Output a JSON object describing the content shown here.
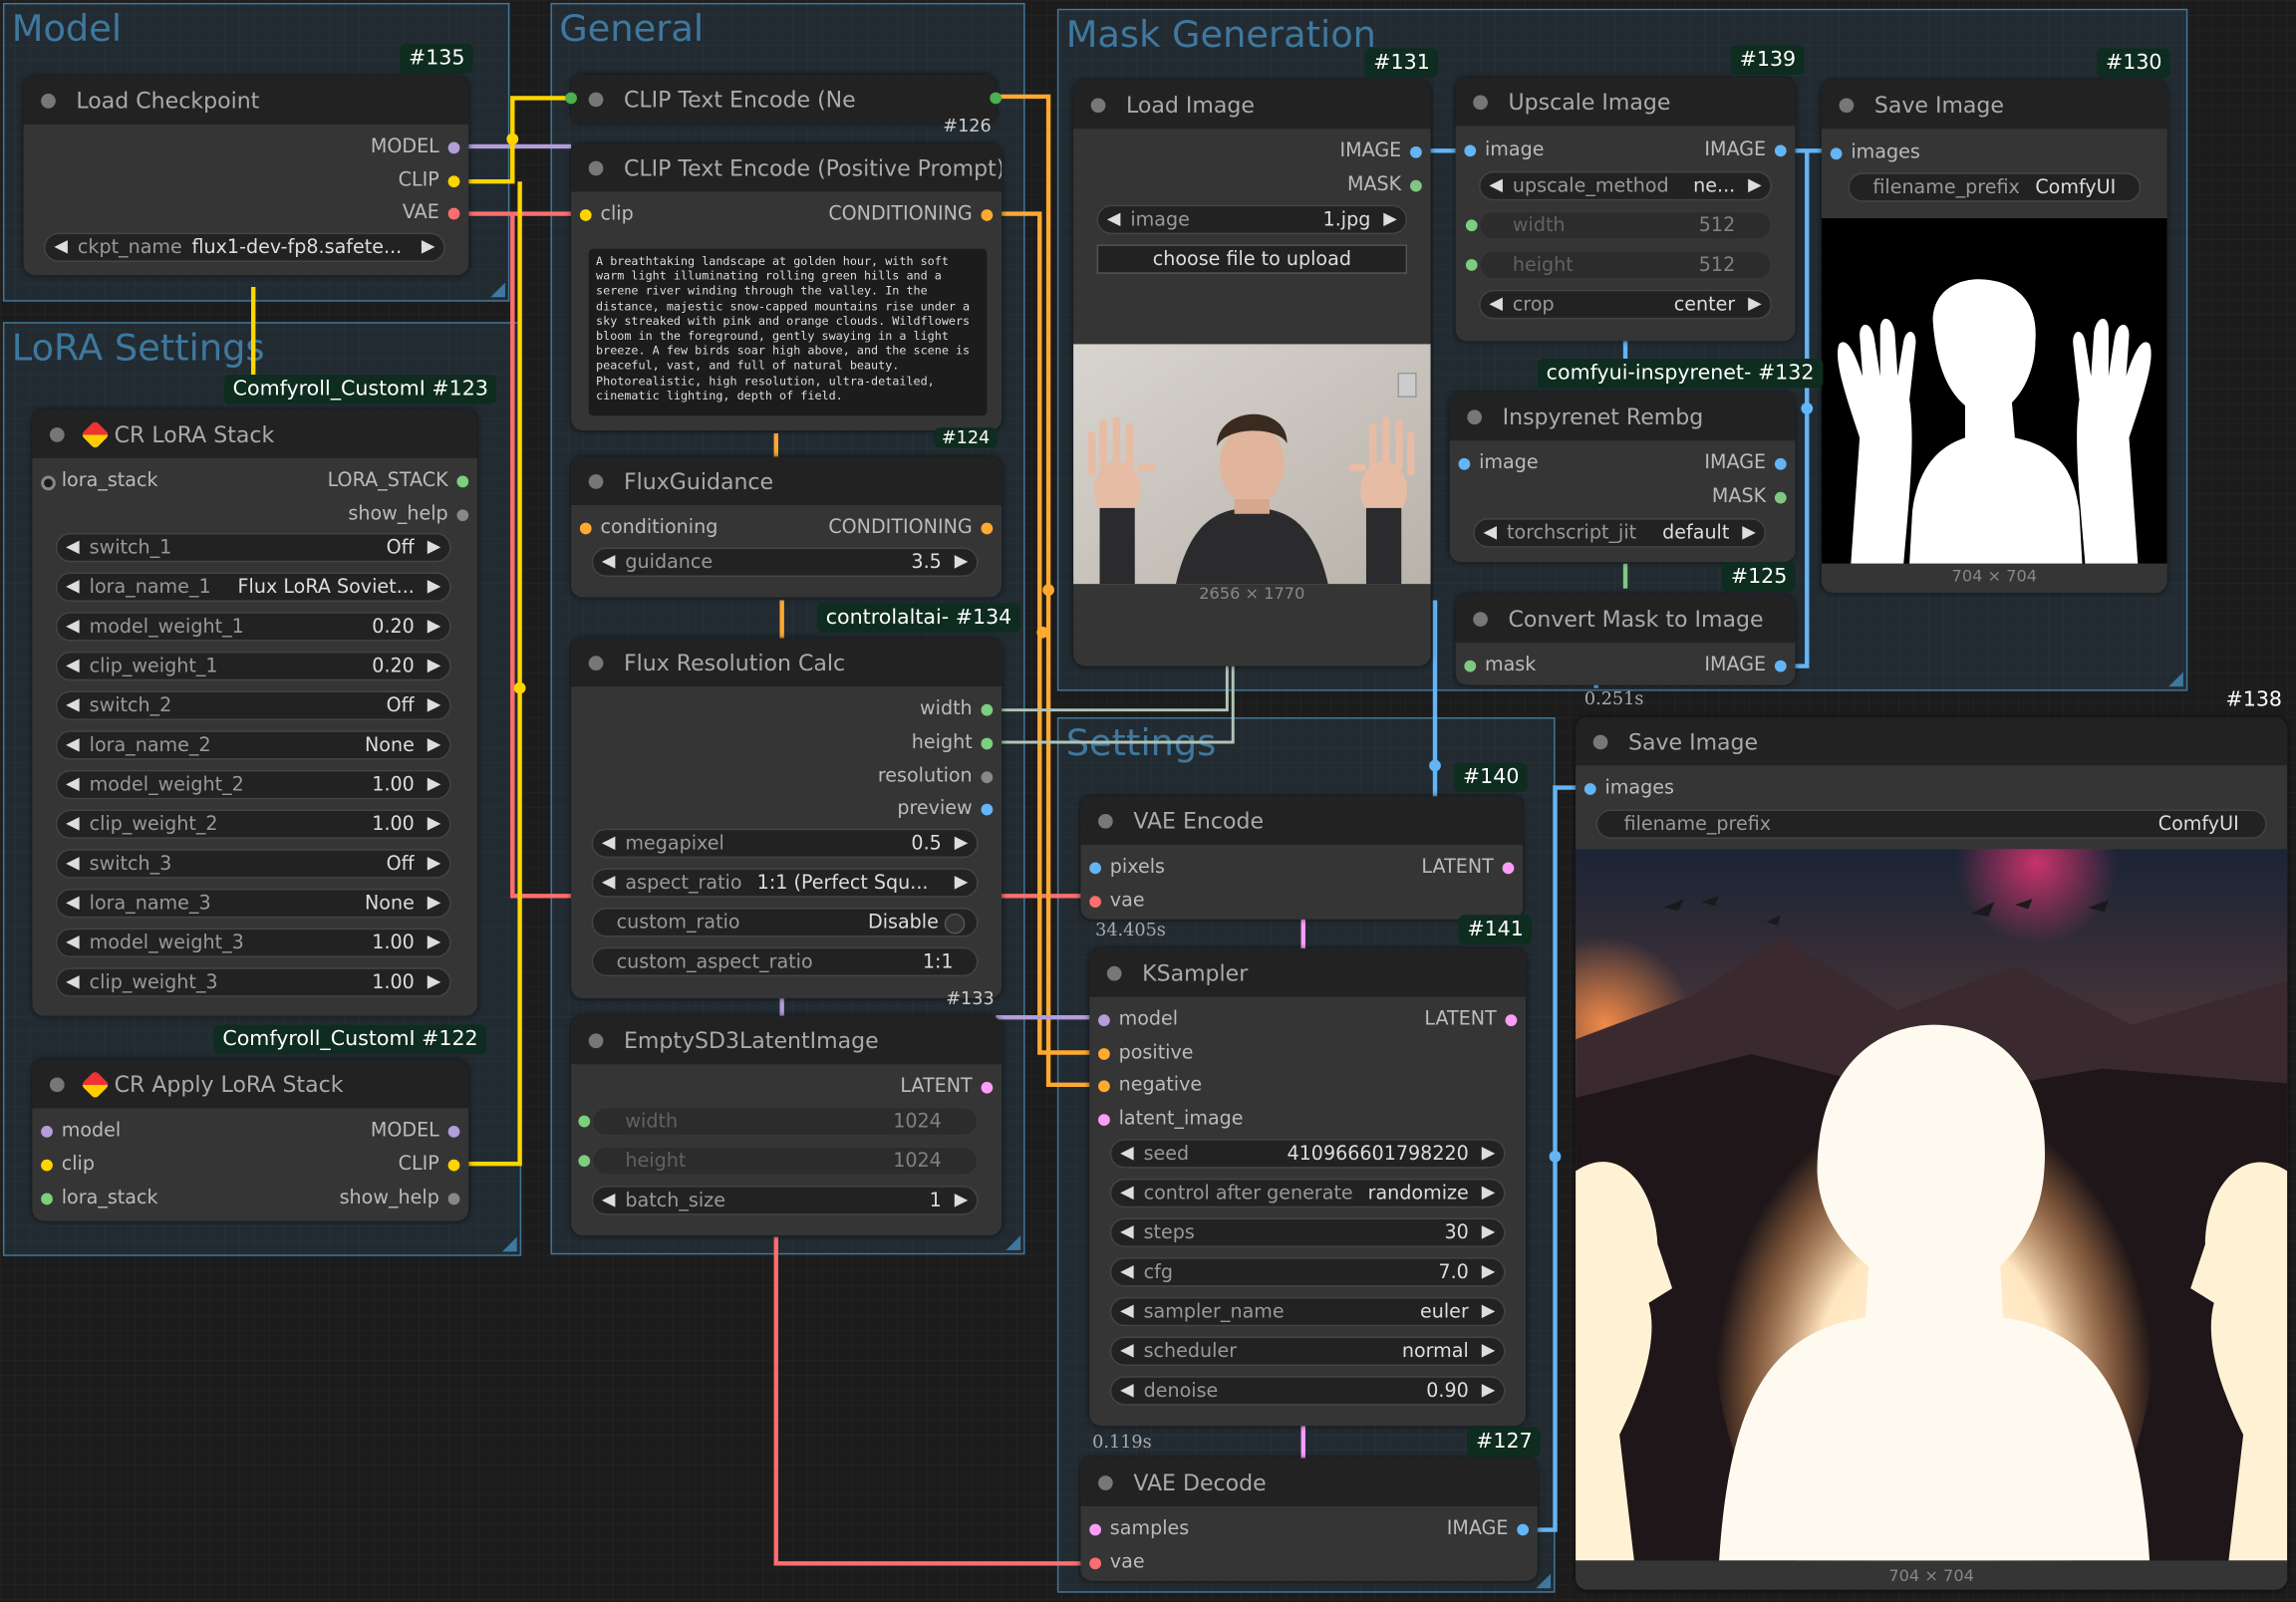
{
  "colors": {
    "model": "#b39ddb",
    "clip": "#ffd500",
    "vae": "#ff6e6e",
    "conditioning": "#ffa931",
    "latent": "#ff9cf9",
    "image": "#64b5f6",
    "mask": "#81c784",
    "int": "#7ccf7c",
    "group": "#3f789e",
    "badge": "#0e2c1f"
  },
  "groups": {
    "model": "Model",
    "general": "General",
    "lora": "LoRA Settings",
    "mask": "Mask Generation",
    "settings": "Settings"
  },
  "nodes": {
    "load_checkpoint": {
      "id": "#135",
      "title": "Load Checkpoint",
      "out": [
        "MODEL",
        "CLIP",
        "VAE"
      ],
      "w_label": "ckpt_name",
      "w_value": "flux1-dev-fp8.safete..."
    },
    "clip_neg": {
      "title": "CLIP Text Encode (Ne",
      "id2": "#126"
    },
    "clip_pos": {
      "title": "CLIP Text Encode (Positive Prompt)",
      "in": "clip",
      "out": "CONDITIONING",
      "text": "A breathtaking landscape at golden hour, with soft warm light illuminating rolling green hills and a serene river winding through the valley. In the distance, majestic snow-capped mountains rise under a sky streaked with pink and orange clouds. Wildflowers bloom in the foreground, gently swaying in a light breeze. A few birds soar high above, and the scene is peaceful, vast, and full of natural beauty. Photorealistic, high resolution, ultra-detailed, cinematic lighting, depth of field.",
      "id": "#124"
    },
    "lora_stack": {
      "badge": "Comfyroll_CustomI",
      "id": "#123",
      "title": "CR LoRA Stack",
      "in": "lora_stack",
      "out1": "LORA_STACK",
      "out2": "show_help",
      "widgets": [
        [
          "switch_1",
          "Off"
        ],
        [
          "lora_name_1",
          "Flux LoRA Soviet..."
        ],
        [
          "model_weight_1",
          "0.20"
        ],
        [
          "clip_weight_1",
          "0.20"
        ],
        [
          "switch_2",
          "Off"
        ],
        [
          "lora_name_2",
          "None"
        ],
        [
          "model_weight_2",
          "1.00"
        ],
        [
          "clip_weight_2",
          "1.00"
        ],
        [
          "switch_3",
          "Off"
        ],
        [
          "lora_name_3",
          "None"
        ],
        [
          "model_weight_3",
          "1.00"
        ],
        [
          "clip_weight_3",
          "1.00"
        ]
      ]
    },
    "apply_lora": {
      "badge": "Comfyroll_CustomI",
      "id": "#122",
      "title": "CR Apply LoRA Stack",
      "ins": [
        "model",
        "clip",
        "lora_stack"
      ],
      "outs": [
        "MODEL",
        "CLIP",
        "show_help"
      ]
    },
    "flux_guidance": {
      "title": "FluxGuidance",
      "in": "conditioning",
      "out": "CONDITIONING",
      "w_label": "guidance",
      "w_value": "3.5"
    },
    "flux_res": {
      "badge": "controlaltai-",
      "id": "#134",
      "title": "Flux Resolution Calc",
      "outs": [
        "width",
        "height",
        "resolution",
        "preview"
      ],
      "widgets": [
        [
          "megapixel",
          "0.5"
        ],
        [
          "aspect_ratio",
          "1:1 (Perfect Squ..."
        ],
        [
          "custom_ratio",
          "Disable"
        ],
        [
          "custom_aspect_ratio",
          "1:1"
        ]
      ]
    },
    "empty_latent": {
      "id": "#133",
      "title": "EmptySD3LatentImage",
      "out": "LATENT",
      "widgets": [
        [
          "width",
          "1024"
        ],
        [
          "height",
          "1024"
        ],
        [
          "batch_size",
          "1"
        ]
      ]
    },
    "load_image": {
      "id": "#131",
      "title": "Load Image",
      "outs": [
        "IMAGE",
        "MASK"
      ],
      "w_label": "image",
      "w_value": "1.jpg",
      "button": "choose file to upload",
      "size": "2656 × 1770"
    },
    "upscale": {
      "id": "#139",
      "title": "Upscale Image",
      "in": "image",
      "out": "IMAGE",
      "widgets": [
        [
          "upscale_method",
          "ne..."
        ],
        [
          "width",
          "512"
        ],
        [
          "height",
          "512"
        ],
        [
          "crop",
          "center"
        ]
      ]
    },
    "inspyrenet": {
      "badge": "comfyui-inspyrenet-",
      "id": "#132",
      "title": "Inspyrenet Rembg",
      "in": "image",
      "outs": [
        "IMAGE",
        "MASK"
      ],
      "w_label": "torchscript_jit",
      "w_value": "default"
    },
    "mask_to_image": {
      "id": "#125",
      "title": "Convert Mask to Image",
      "in": "mask",
      "out": "IMAGE",
      "timer": "0.251s"
    },
    "save_top": {
      "id": "#130",
      "title": "Save Image",
      "in": "images",
      "w_label": "filename_prefix",
      "w_value": "ComfyUI",
      "size": "704 × 704"
    },
    "save_big": {
      "id": "#138",
      "title": "Save Image",
      "in": "images",
      "w_label": "filename_prefix",
      "w_value": "ComfyUI",
      "size": "704 × 704"
    },
    "vae_encode": {
      "id": "#140",
      "title": "VAE Encode",
      "ins": [
        "pixels",
        "vae"
      ],
      "out": "LATENT",
      "timer": "34.405s"
    },
    "ksampler": {
      "id": "#141",
      "title": "KSampler",
      "ins": [
        "model",
        "positive",
        "negative",
        "latent_image"
      ],
      "out": "LATENT",
      "timer": "0.119s",
      "widgets": [
        [
          "seed",
          "410966601798220"
        ],
        [
          "control after generate",
          "randomize"
        ],
        [
          "steps",
          "30"
        ],
        [
          "cfg",
          "7.0"
        ],
        [
          "sampler_name",
          "euler"
        ],
        [
          "scheduler",
          "normal"
        ],
        [
          "denoise",
          "0.90"
        ]
      ]
    },
    "vae_decode": {
      "id": "#127",
      "title": "VAE Decode",
      "ins": [
        "samples",
        "vae"
      ],
      "out": "IMAGE"
    }
  }
}
